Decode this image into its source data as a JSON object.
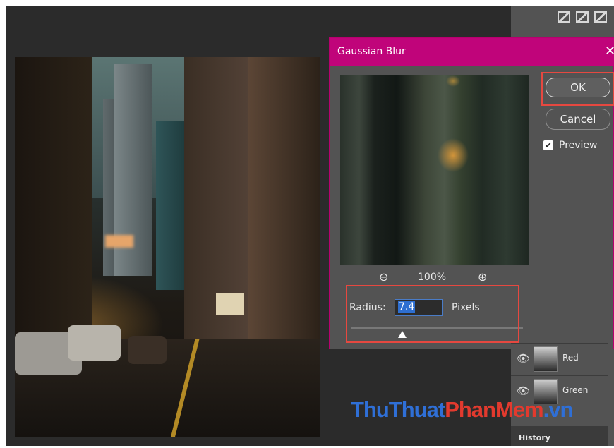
{
  "dialog": {
    "title": "Gaussian Blur",
    "close_glyph": "✕",
    "zoom": {
      "out_glyph": "⊖",
      "value": "100%",
      "in_glyph": "⊕"
    },
    "radius": {
      "label": "Radius:",
      "value": "7.4",
      "unit": "Pixels",
      "slider_fraction": 0.3
    },
    "ok_label": "OK",
    "cancel_label": "Cancel",
    "preview": {
      "label": "Preview",
      "checked": true
    }
  },
  "layers": [
    {
      "name": "Red",
      "visible": true
    },
    {
      "name": "Green",
      "visible": true
    }
  ],
  "history_tab": "History",
  "watermark": {
    "part1": "ThuThuat",
    "part2": "PhanMem",
    "part3": ".vn"
  },
  "colors": {
    "title_bar": "#c0047a",
    "highlight": "#e64840",
    "dialog_bg": "#535353"
  },
  "icons": [
    "eye-icon",
    "zoom-out-icon",
    "zoom-in-icon",
    "checkbox-icon",
    "close-icon"
  ]
}
